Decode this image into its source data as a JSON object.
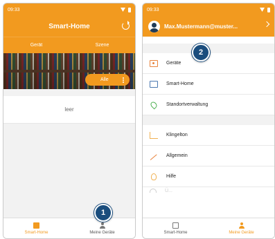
{
  "left": {
    "status_time": "09:33",
    "title": "Smart-Home",
    "tabs": [
      "Gerät",
      "Szene"
    ],
    "filter_chip": "Alle",
    "empty_text": "leer",
    "nav": [
      "Smart-Home",
      "Meine Geräte"
    ],
    "badge": "1"
  },
  "right": {
    "status_time": "09:33",
    "account": "Max.Mustermann@muster...",
    "menu_group1": [
      "Geräte",
      "Smart-Home",
      "Standortverwaltung"
    ],
    "menu_group2": [
      "Klingelton",
      "Allgemein",
      "Hilfe"
    ],
    "menu_faded": "Ü...",
    "nav": [
      "Smart-Home",
      "Meine Geräte"
    ],
    "badge": "2"
  },
  "colors": {
    "accent": "#f29a1f",
    "badge": "#1a4d7d"
  }
}
